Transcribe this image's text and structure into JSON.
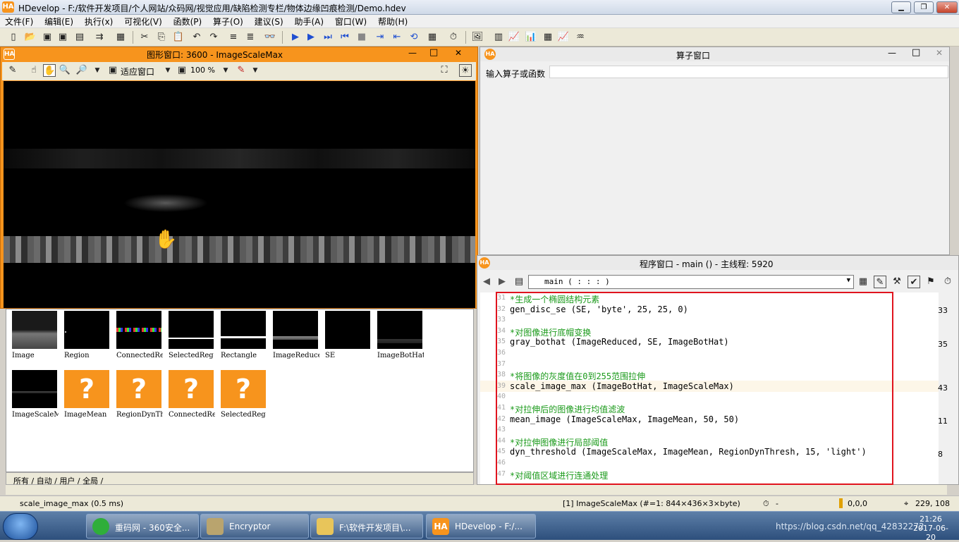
{
  "titlebar": {
    "logo": "HA",
    "title": "HDevelop - F:/软件开发项目/个人网站/众码网/视觉应用/缺陷检测专栏/物体边缘凹痕检测/Demo.hdev",
    "minimize": "▁",
    "maximize": "❐",
    "close": "✕"
  },
  "menu": [
    "文件(F)",
    "编辑(E)",
    "执行(x)",
    "可视化(V)",
    "函数(P)",
    "算子(O)",
    "建议(S)",
    "助手(A)",
    "窗口(W)",
    "帮助(H)"
  ],
  "graphics": {
    "title": "图形窗口: 3600 - ImageScaleMax",
    "fit_label": "适应窗口",
    "zoom": "100 %",
    "min": "—",
    "max": "□",
    "close": "✕"
  },
  "thumbnails": [
    {
      "label": "Image",
      "kind": "image"
    },
    {
      "label": "Region",
      "kind": "image"
    },
    {
      "label": "ConnectedRe",
      "kind": "image"
    },
    {
      "label": "SelectedReg",
      "kind": "image"
    },
    {
      "label": "Rectangle",
      "kind": "image"
    },
    {
      "label": "ImageReduce",
      "kind": "image"
    },
    {
      "label": "SE",
      "kind": "image"
    },
    {
      "label": "ImageBotHat",
      "kind": "image"
    },
    {
      "label": "ImageScaleM",
      "kind": "image"
    },
    {
      "label": "ImageMean",
      "kind": "unknown",
      "glyph": "?"
    },
    {
      "label": "RegionDynTh",
      "kind": "unknown",
      "glyph": "?"
    },
    {
      "label": "ConnectedRe",
      "kind": "unknown",
      "glyph": "?"
    },
    {
      "label": "SelectedReg",
      "kind": "unknown",
      "glyph": "?"
    }
  ],
  "var_tabs": "所有 / 自动 / 用户 / 全局 /",
  "operator": {
    "title": "算子窗口",
    "input_label": "输入算子或函数"
  },
  "program": {
    "title": "程序窗口 - main () - 主线程: 5920",
    "procedure": "main ( : : : )"
  },
  "code": [
    {
      "num": "31",
      "text": "*生成一个椭圆结构元素",
      "type": "comment"
    },
    {
      "num": "32",
      "text": "gen_disc_se (SE, 'byte', 25, 25, 0)",
      "type": "code"
    },
    {
      "num": "33",
      "text": "",
      "type": "blank"
    },
    {
      "num": "34",
      "text": "*对图像进行底帽变换",
      "type": "comment"
    },
    {
      "num": "35",
      "text": "gray_bothat (ImageReduced, SE, ImageBotHat)",
      "type": "code"
    },
    {
      "num": "36",
      "text": "",
      "type": "blank"
    },
    {
      "num": "37",
      "text": "",
      "type": "blank"
    },
    {
      "num": "38",
      "text": "*将图像的灰度值在0到255范围拉伸",
      "type": "comment"
    },
    {
      "num": "39",
      "text": "scale_image_max (ImageBotHat, ImageScaleMax)",
      "type": "code"
    },
    {
      "num": "40",
      "text": "",
      "type": "blank"
    },
    {
      "num": "41",
      "text": "*对拉伸后的图像进行均值滤波",
      "type": "comment"
    },
    {
      "num": "42",
      "text": "mean_image (ImageScaleMax, ImageMean, 50, 50)",
      "type": "code"
    },
    {
      "num": "43",
      "text": "",
      "type": "blank"
    },
    {
      "num": "44",
      "text": "*对拉伸图像进行局部阈值",
      "type": "comment"
    },
    {
      "num": "45",
      "text": "dyn_threshold (ImageScaleMax, ImageMean, RegionDynThresh, 15, 'light')",
      "type": "code"
    },
    {
      "num": "46",
      "text": "",
      "type": "blank"
    },
    {
      "num": "47",
      "text": "*对阈值区域进行连通处理",
      "type": "comment"
    }
  ],
  "gutter": [
    "33",
    "35",
    "43",
    "11",
    "8"
  ],
  "status": {
    "message": "scale_image_max (0.5 ms)",
    "image_info": "[1] ImageScaleMax (#=1: 844×436×3×byte)",
    "dash": "-",
    "gray": "0,0,0",
    "coords": "229, 108"
  },
  "taskbar": {
    "tasks": [
      "重码网 - 360安全...",
      "Encryptor",
      "F:\\软件开发项目\\...",
      "HDevelop - F:/..."
    ],
    "time": "21:26",
    "date": "2017-06-20",
    "watermark": "https://blog.csdn.net/qq_42832272"
  }
}
